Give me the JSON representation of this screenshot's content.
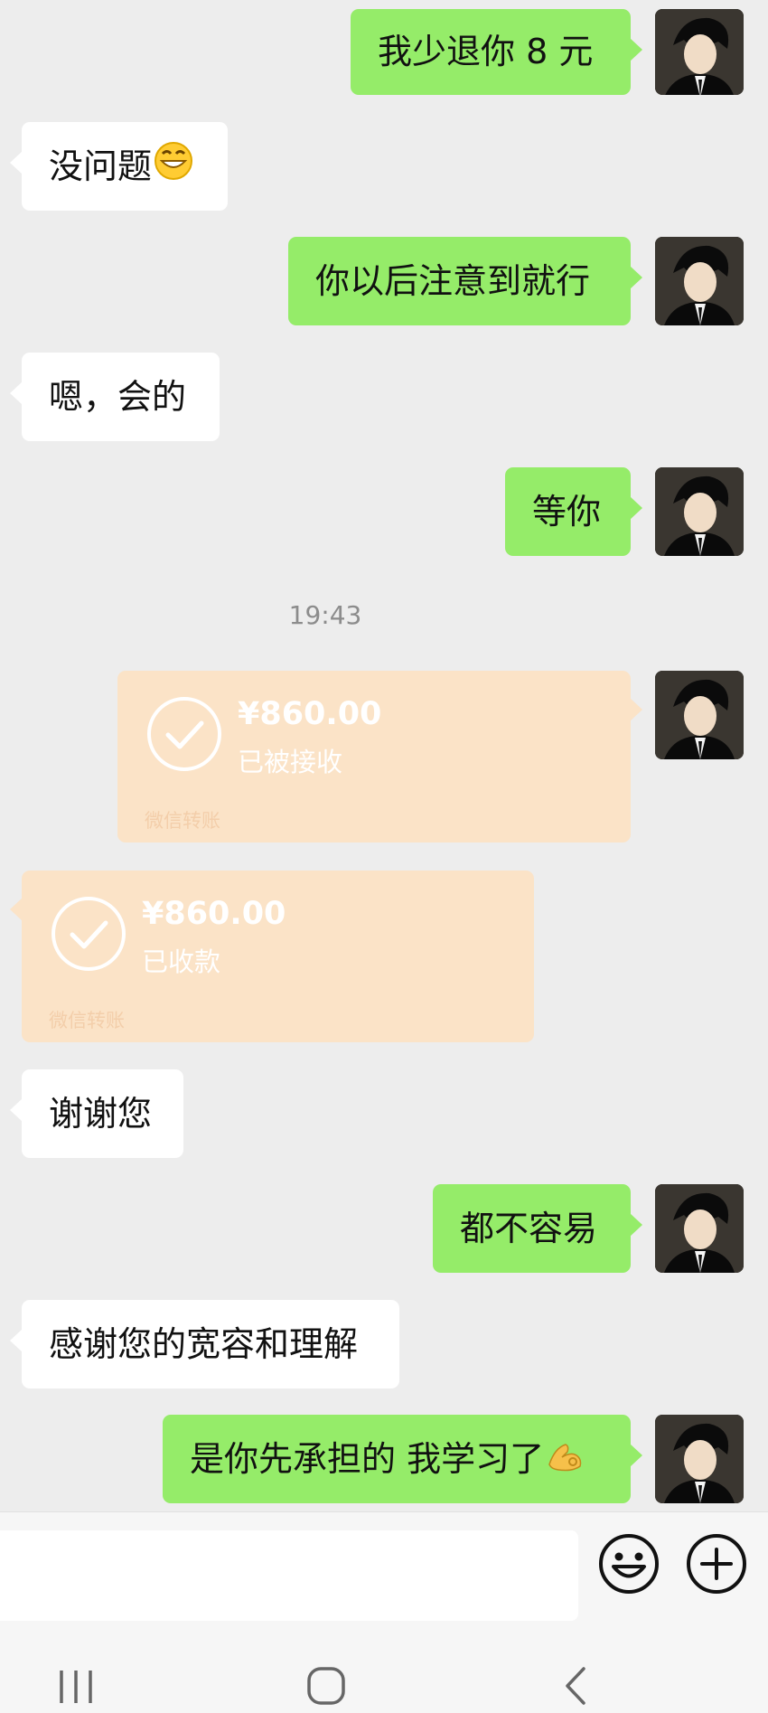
{
  "messages": [
    {
      "side": "out",
      "text": "我少退你 8 元"
    },
    {
      "side": "in",
      "text": "没问题",
      "emoji": "grinning-face"
    },
    {
      "side": "out",
      "text": "你以后注意到就行"
    },
    {
      "side": "in",
      "text": "嗯，会的"
    },
    {
      "side": "out",
      "text": "等你"
    },
    {
      "side": "in",
      "text": "谢谢您"
    },
    {
      "side": "out",
      "text": "都不容易"
    },
    {
      "side": "in",
      "text": "感谢您的宽容和理解"
    },
    {
      "side": "out",
      "text": "是你先承担的 我学习了",
      "emoji": "ok-hand"
    }
  ],
  "timestamp": "19:43",
  "transfers": [
    {
      "side": "out",
      "amount": "¥860.00",
      "status": "已被接收",
      "label": "微信转账"
    },
    {
      "side": "in",
      "amount": "¥860.00",
      "status": "已收款",
      "label": "微信转账"
    }
  ],
  "composer": {
    "placeholder": "",
    "icons": [
      "smiley-icon",
      "plus-circle-icon"
    ]
  },
  "navbar": {
    "icons": [
      "recent-apps-icon",
      "home-icon",
      "back-icon"
    ]
  },
  "colors": {
    "outgoing_bubble": "#95ec69",
    "incoming_bubble": "#ffffff",
    "transfer_card": "#fbe3c7",
    "background": "#ededed"
  }
}
